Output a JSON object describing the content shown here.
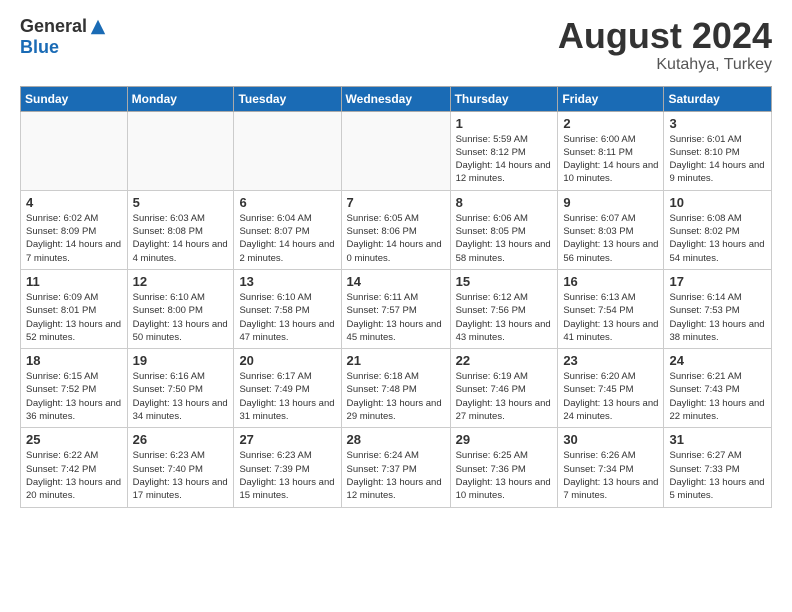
{
  "header": {
    "logo_general": "General",
    "logo_blue": "Blue",
    "month_title": "August 2024",
    "subtitle": "Kutahya, Turkey"
  },
  "weekdays": [
    "Sunday",
    "Monday",
    "Tuesday",
    "Wednesday",
    "Thursday",
    "Friday",
    "Saturday"
  ],
  "weeks": [
    [
      {
        "day": "",
        "empty": true
      },
      {
        "day": "",
        "empty": true
      },
      {
        "day": "",
        "empty": true
      },
      {
        "day": "",
        "empty": true
      },
      {
        "day": "1",
        "sunrise": "5:59 AM",
        "sunset": "8:12 PM",
        "daylight": "14 hours and 12 minutes."
      },
      {
        "day": "2",
        "sunrise": "6:00 AM",
        "sunset": "8:11 PM",
        "daylight": "14 hours and 10 minutes."
      },
      {
        "day": "3",
        "sunrise": "6:01 AM",
        "sunset": "8:10 PM",
        "daylight": "14 hours and 9 minutes."
      }
    ],
    [
      {
        "day": "4",
        "sunrise": "6:02 AM",
        "sunset": "8:09 PM",
        "daylight": "14 hours and 7 minutes."
      },
      {
        "day": "5",
        "sunrise": "6:03 AM",
        "sunset": "8:08 PM",
        "daylight": "14 hours and 4 minutes."
      },
      {
        "day": "6",
        "sunrise": "6:04 AM",
        "sunset": "8:07 PM",
        "daylight": "14 hours and 2 minutes."
      },
      {
        "day": "7",
        "sunrise": "6:05 AM",
        "sunset": "8:06 PM",
        "daylight": "14 hours and 0 minutes."
      },
      {
        "day": "8",
        "sunrise": "6:06 AM",
        "sunset": "8:05 PM",
        "daylight": "13 hours and 58 minutes."
      },
      {
        "day": "9",
        "sunrise": "6:07 AM",
        "sunset": "8:03 PM",
        "daylight": "13 hours and 56 minutes."
      },
      {
        "day": "10",
        "sunrise": "6:08 AM",
        "sunset": "8:02 PM",
        "daylight": "13 hours and 54 minutes."
      }
    ],
    [
      {
        "day": "11",
        "sunrise": "6:09 AM",
        "sunset": "8:01 PM",
        "daylight": "13 hours and 52 minutes."
      },
      {
        "day": "12",
        "sunrise": "6:10 AM",
        "sunset": "8:00 PM",
        "daylight": "13 hours and 50 minutes."
      },
      {
        "day": "13",
        "sunrise": "6:10 AM",
        "sunset": "7:58 PM",
        "daylight": "13 hours and 47 minutes."
      },
      {
        "day": "14",
        "sunrise": "6:11 AM",
        "sunset": "7:57 PM",
        "daylight": "13 hours and 45 minutes."
      },
      {
        "day": "15",
        "sunrise": "6:12 AM",
        "sunset": "7:56 PM",
        "daylight": "13 hours and 43 minutes."
      },
      {
        "day": "16",
        "sunrise": "6:13 AM",
        "sunset": "7:54 PM",
        "daylight": "13 hours and 41 minutes."
      },
      {
        "day": "17",
        "sunrise": "6:14 AM",
        "sunset": "7:53 PM",
        "daylight": "13 hours and 38 minutes."
      }
    ],
    [
      {
        "day": "18",
        "sunrise": "6:15 AM",
        "sunset": "7:52 PM",
        "daylight": "13 hours and 36 minutes."
      },
      {
        "day": "19",
        "sunrise": "6:16 AM",
        "sunset": "7:50 PM",
        "daylight": "13 hours and 34 minutes."
      },
      {
        "day": "20",
        "sunrise": "6:17 AM",
        "sunset": "7:49 PM",
        "daylight": "13 hours and 31 minutes."
      },
      {
        "day": "21",
        "sunrise": "6:18 AM",
        "sunset": "7:48 PM",
        "daylight": "13 hours and 29 minutes."
      },
      {
        "day": "22",
        "sunrise": "6:19 AM",
        "sunset": "7:46 PM",
        "daylight": "13 hours and 27 minutes."
      },
      {
        "day": "23",
        "sunrise": "6:20 AM",
        "sunset": "7:45 PM",
        "daylight": "13 hours and 24 minutes."
      },
      {
        "day": "24",
        "sunrise": "6:21 AM",
        "sunset": "7:43 PM",
        "daylight": "13 hours and 22 minutes."
      }
    ],
    [
      {
        "day": "25",
        "sunrise": "6:22 AM",
        "sunset": "7:42 PM",
        "daylight": "13 hours and 20 minutes."
      },
      {
        "day": "26",
        "sunrise": "6:23 AM",
        "sunset": "7:40 PM",
        "daylight": "13 hours and 17 minutes."
      },
      {
        "day": "27",
        "sunrise": "6:23 AM",
        "sunset": "7:39 PM",
        "daylight": "13 hours and 15 minutes."
      },
      {
        "day": "28",
        "sunrise": "6:24 AM",
        "sunset": "7:37 PM",
        "daylight": "13 hours and 12 minutes."
      },
      {
        "day": "29",
        "sunrise": "6:25 AM",
        "sunset": "7:36 PM",
        "daylight": "13 hours and 10 minutes."
      },
      {
        "day": "30",
        "sunrise": "6:26 AM",
        "sunset": "7:34 PM",
        "daylight": "13 hours and 7 minutes."
      },
      {
        "day": "31",
        "sunrise": "6:27 AM",
        "sunset": "7:33 PM",
        "daylight": "13 hours and 5 minutes."
      }
    ]
  ]
}
